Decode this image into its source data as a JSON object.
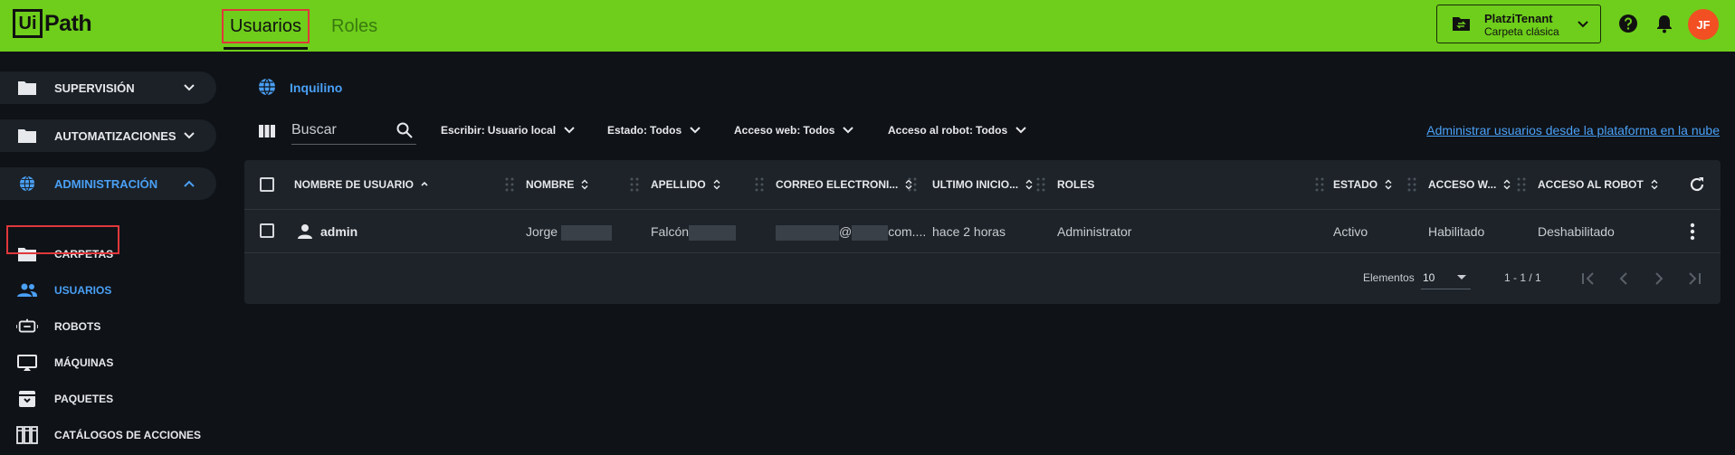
{
  "header": {
    "logo_box": "Ui",
    "logo_text": "Path",
    "tabs": [
      {
        "label": "Usuarios",
        "active": true
      },
      {
        "label": "Roles",
        "active": false
      }
    ],
    "tenant": {
      "name": "PlatziTenant",
      "folder": "Carpeta clásica"
    },
    "help_icon": "help-circle-icon",
    "notifications_icon": "bell-icon",
    "avatar_initials": "JF",
    "accent_color": "#6ece1b",
    "avatar_color": "#f24f23"
  },
  "sidebar": {
    "sections": [
      {
        "label": "SUPERVISIÓN",
        "icon": "folder-icon",
        "expanded": false
      },
      {
        "label": "AUTOMATIZACIONES",
        "icon": "folder-icon",
        "expanded": false
      },
      {
        "label": "ADMINISTRACIÓN",
        "icon": "globe-icon",
        "expanded": true
      }
    ],
    "items": [
      {
        "label": "CARPETAS",
        "icon": "folder-icon"
      },
      {
        "label": "USUARIOS",
        "icon": "users-icon",
        "active": true
      },
      {
        "label": "ROBOTS",
        "icon": "robot-icon"
      },
      {
        "label": "MÁQUINAS",
        "icon": "monitor-icon"
      },
      {
        "label": "PAQUETES",
        "icon": "package-icon"
      },
      {
        "label": "CATÁLOGOS DE ACCIONES",
        "icon": "catalog-icon"
      }
    ]
  },
  "main": {
    "breadcrumb": "Inquilino",
    "search_placeholder": "Buscar",
    "filters": [
      {
        "key": "Escribir:",
        "value": "Usuario local"
      },
      {
        "key": "Estado:",
        "value": "Todos"
      },
      {
        "key": "Acceso web:",
        "value": "Todos"
      },
      {
        "key": "Acceso al robot:",
        "value": "Todos"
      }
    ],
    "cloud_link": "Administrar usuarios desde la plataforma en la nube",
    "table": {
      "columns": [
        "NOMBRE DE USUARIO",
        "NOMBRE",
        "APELLIDO",
        "CORREO ELECTRONI...",
        "ULTIMO INICIO...",
        "ROLES",
        "ESTADO",
        "ACCESO W...",
        "ACCESO AL ROBOT"
      ],
      "rows": [
        {
          "username": "admin",
          "first_name": "Jorge",
          "last_name": "Falcón",
          "email_at": "@",
          "email_domain": "com....",
          "last_login": "hace 2 horas",
          "roles": "Administrator",
          "status": "Activo",
          "web_access": "Habilitado",
          "robot_access": "Deshabilitado"
        }
      ]
    },
    "footer": {
      "items_label": "Elementos",
      "page_size": "10",
      "range": "1 - 1 / 1"
    }
  }
}
